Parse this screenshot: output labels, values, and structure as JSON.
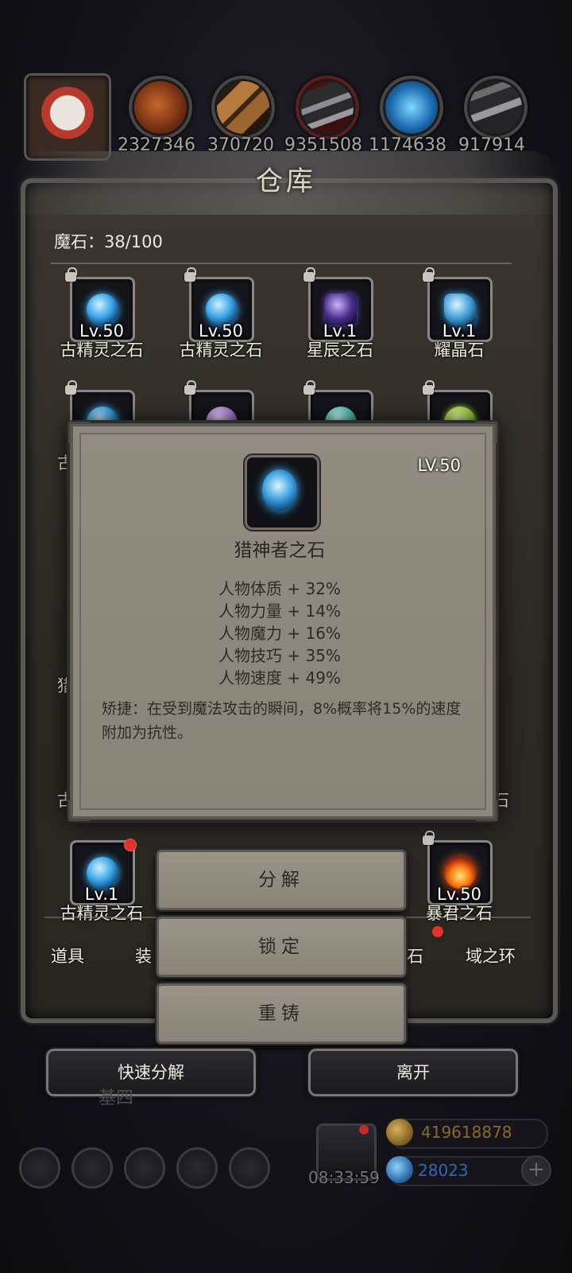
{
  "resources": {
    "values": [
      "2327346",
      "370720",
      "9351508",
      "1174638",
      "917914"
    ],
    "icons": [
      "ore-orb-icon",
      "wood-planks-icon",
      "iron-ingot-icon",
      "blue-crystal-icon",
      "steel-ingot-icon"
    ]
  },
  "warehouse": {
    "title": "仓库",
    "capacity_label": "魔石：38/100"
  },
  "grid": {
    "row1": [
      {
        "level": "Lv.50",
        "name": "古精灵之石",
        "icon": "blue-orb-gem-icon",
        "locked": true
      },
      {
        "level": "Lv.50",
        "name": "古精灵之石",
        "icon": "blue-orb-gem-icon",
        "locked": true
      },
      {
        "level": "Lv.1",
        "name": "星辰之石",
        "icon": "purple-star-gem-icon",
        "locked": true
      },
      {
        "level": "Lv.1",
        "name": "耀晶石",
        "icon": "blue-crystal-gem-icon",
        "locked": true
      }
    ],
    "row_last": [
      {
        "level": "Lv.1",
        "name": "古精灵之石",
        "icon": "blue-orb-gem-icon",
        "has_badge": true
      },
      {
        "level": "Lv.50",
        "name": "暴君之石",
        "icon": "fire-gem-icon",
        "locked": true
      }
    ],
    "partial_left_1": "古",
    "partial_left_2": "猎",
    "partial_left_3": "古",
    "partial_right_3": "石"
  },
  "tabs": {
    "items": [
      "道具",
      "装",
      "石",
      "域之环"
    ]
  },
  "popup": {
    "level": "LV.50",
    "name": "猎神者之石",
    "stats": [
      "人物体质 + 32%",
      "人物力量 + 14%",
      "人物魔力 + 16%",
      "人物技巧 + 35%",
      "人物速度 + 49%"
    ],
    "description": "矫捷：在受到魔法攻击的瞬间，8%概率将15%的速度附加为抗性。"
  },
  "actions": {
    "decompose": "分解",
    "lock": "锁定",
    "reforge": "重铸"
  },
  "bottom": {
    "quick_decompose": "快速分解",
    "leave": "离开",
    "background_text": "基四"
  },
  "hud": {
    "timer": "08:33:59",
    "gold": "419618878",
    "gems": "28023",
    "plus": "+"
  },
  "colors": {
    "gold_text": "#8a6a2a",
    "gem_text": "#2f69b5",
    "badge_red": "#e5322d"
  }
}
